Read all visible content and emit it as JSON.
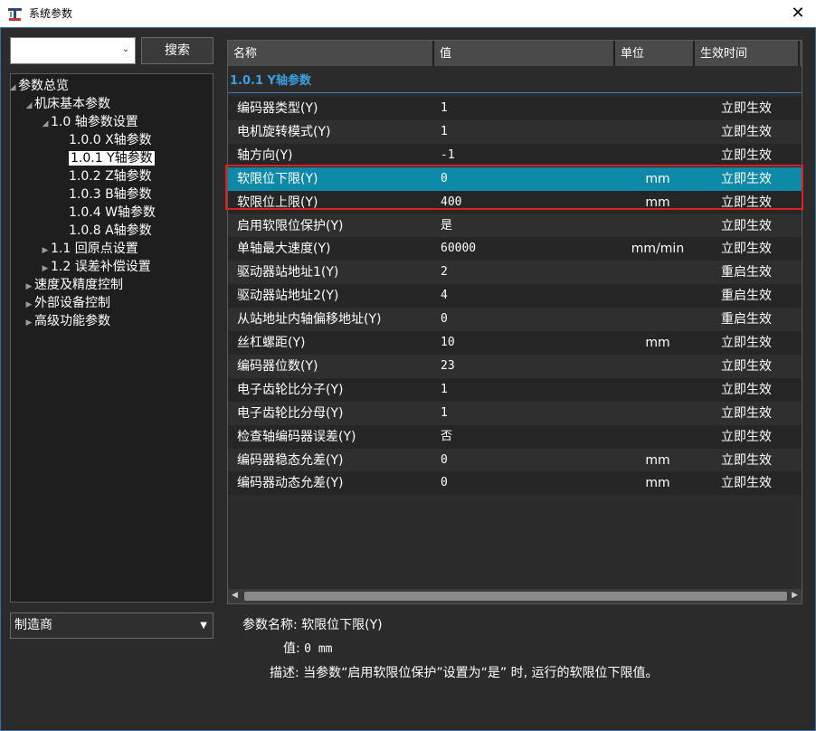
{
  "window": {
    "title": "系统参数",
    "close_label": "✕"
  },
  "search": {
    "input_value": "",
    "button_label": "搜索"
  },
  "tree": {
    "items": [
      {
        "label": "参数总览",
        "arrow": "◢"
      },
      {
        "label": "机床基本参数",
        "arrow": "◢"
      },
      {
        "label": "1.0 轴参数设置",
        "arrow": "◢"
      },
      {
        "label": "1.0.0 X轴参数",
        "arrow": ""
      },
      {
        "label": "1.0.1 Y轴参数",
        "arrow": ""
      },
      {
        "label": "1.0.2 Z轴参数",
        "arrow": ""
      },
      {
        "label": "1.0.3 B轴参数",
        "arrow": ""
      },
      {
        "label": "1.0.4 W轴参数",
        "arrow": ""
      },
      {
        "label": "1.0.8 A轴参数",
        "arrow": ""
      },
      {
        "label": "1.1 回原点设置",
        "arrow": "▶"
      },
      {
        "label": "1.2 误差补偿设置",
        "arrow": "▶"
      },
      {
        "label": "速度及精度控制",
        "arrow": "▶"
      },
      {
        "label": "外部设备控制",
        "arrow": "▶"
      },
      {
        "label": "高级功能参数",
        "arrow": "▶"
      }
    ]
  },
  "maker_select": {
    "value": "制造商"
  },
  "table": {
    "headers": [
      "名称",
      "值",
      "单位",
      "生效时间"
    ],
    "group_label": "1.0.1 Y轴参数",
    "rows": [
      {
        "name": "编码器类型(Y)",
        "value": "1",
        "unit": "",
        "effect": "立即生效"
      },
      {
        "name": "电机旋转模式(Y)",
        "value": "1",
        "unit": "",
        "effect": "立即生效"
      },
      {
        "name": "轴方向(Y)",
        "value": "-1",
        "unit": "",
        "effect": "立即生效"
      },
      {
        "name": "软限位下限(Y)",
        "value": "0",
        "unit": "mm",
        "effect": "立即生效"
      },
      {
        "name": "软限位上限(Y)",
        "value": "400",
        "unit": "mm",
        "effect": "立即生效"
      },
      {
        "name": "启用软限位保护(Y)",
        "value": "是",
        "unit": "",
        "effect": "立即生效"
      },
      {
        "name": "单轴最大速度(Y)",
        "value": "60000",
        "unit": "mm/min",
        "effect": "立即生效"
      },
      {
        "name": "驱动器站地址1(Y)",
        "value": "2",
        "unit": "",
        "effect": "重启生效"
      },
      {
        "name": "驱动器站地址2(Y)",
        "value": "4",
        "unit": "",
        "effect": "重启生效"
      },
      {
        "name": "从站地址内轴偏移地址(Y)",
        "value": "0",
        "unit": "",
        "effect": "重启生效"
      },
      {
        "name": "丝杠螺距(Y)",
        "value": "10",
        "unit": "mm",
        "effect": "立即生效"
      },
      {
        "name": "编码器位数(Y)",
        "value": "23",
        "unit": "",
        "effect": "立即生效"
      },
      {
        "name": "电子齿轮比分子(Y)",
        "value": "1",
        "unit": "",
        "effect": "立即生效"
      },
      {
        "name": "电子齿轮比分母(Y)",
        "value": "1",
        "unit": "",
        "effect": "立即生效"
      },
      {
        "name": "检查轴编码器误差(Y)",
        "value": "否",
        "unit": "",
        "effect": "立即生效"
      },
      {
        "name": "编码器稳态允差(Y)",
        "value": "0",
        "unit": "mm",
        "effect": "立即生效"
      },
      {
        "name": "编码器动态允差(Y)",
        "value": "0",
        "unit": "mm",
        "effect": "立即生效"
      }
    ]
  },
  "details": {
    "name_label": "参数名称:",
    "name_value": "软限位下限(Y)",
    "value_label": "值:",
    "value_value": "0 mm",
    "desc_label": "描述:",
    "desc_value": "当参数“启用软限位保护”设置为“是” 时, 运行的软限位下限值。"
  },
  "colors": {
    "selection": "#0e8aa8",
    "group_text": "#3aa0e0",
    "highlight_border": "#e02020"
  }
}
